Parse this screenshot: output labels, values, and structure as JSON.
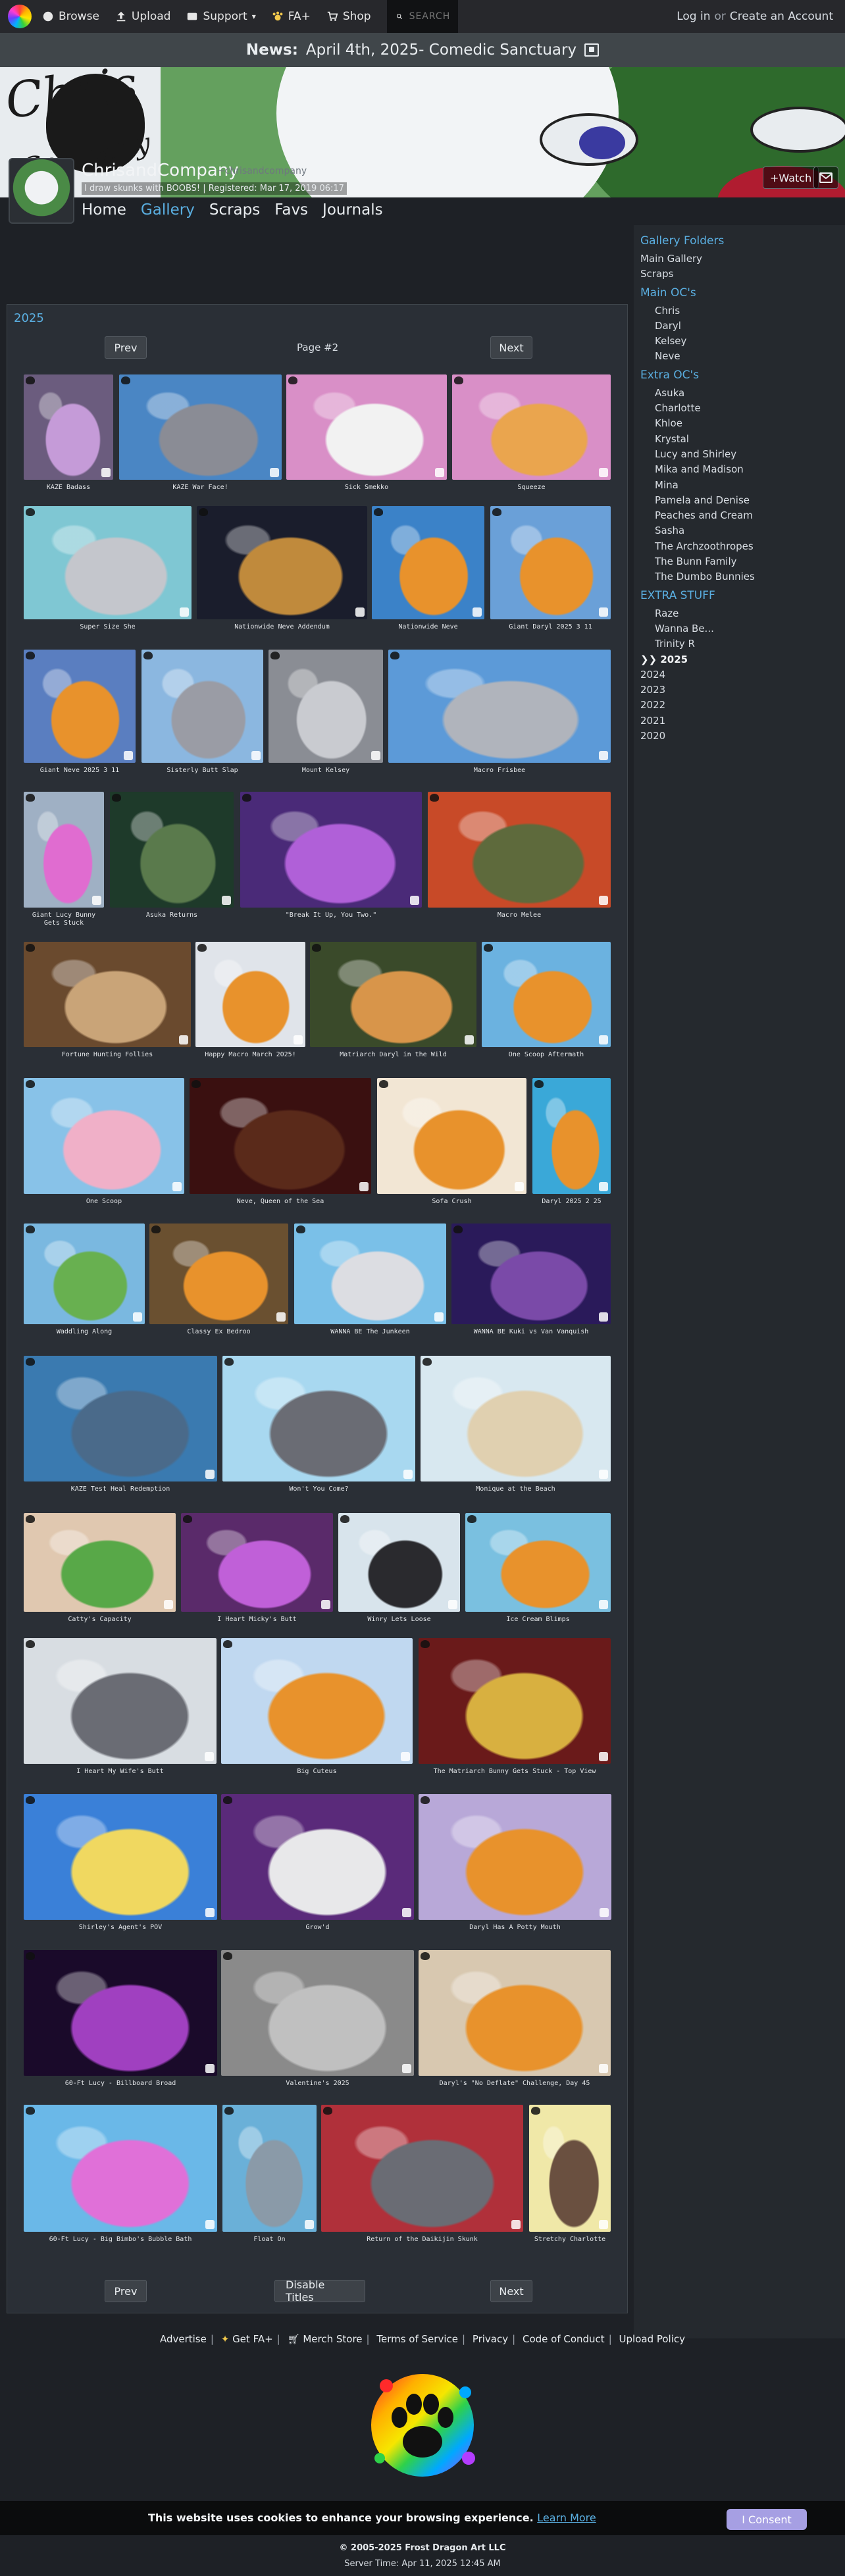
{
  "nav": {
    "browse": "Browse",
    "upload": "Upload",
    "support": "Support",
    "fa_plus": "FA+",
    "shop": "Shop",
    "search_placeholder": "SEARCH",
    "login": "Log in",
    "or": "or",
    "create_account": "Create an Account"
  },
  "news": {
    "label": "News:",
    "text": "April 4th, 2025- Comedic Sanctuary"
  },
  "profile": {
    "username": "ChrisandCompany",
    "title": "~chrisandcompany",
    "description": "I draw skunks with BOOBS! | Registered: Mar 17, 2019 06:17",
    "watch": "+Watch",
    "tabs": [
      "Home",
      "Gallery",
      "Scraps",
      "Favs",
      "Journals"
    ]
  },
  "gallery": {
    "year": "2025",
    "prev": "Prev",
    "next": "Next",
    "page": "Page #2",
    "disable_titles": "Disable Titles",
    "items": [
      {
        "title": "KAZE Badass",
        "bg": "#6b5c7e",
        "fg": "#c59bd8"
      },
      {
        "title": "KAZE War Face!",
        "bg": "#4a86c4",
        "fg": "#8a8c95"
      },
      {
        "title": "Sick Smekko",
        "bg": "#d98fc7",
        "fg": "#f2f2f2"
      },
      {
        "title": "Squeeze",
        "bg": "#d98fc7",
        "fg": "#eaa54e"
      },
      {
        "title": "Super Size She",
        "bg": "#7fc7d3",
        "fg": "#c4c6cc"
      },
      {
        "title": "Nationwide Neve Addendum",
        "bg": "#1a1d2c",
        "fg": "#c08a3c"
      },
      {
        "title": "Nationwide Neve",
        "bg": "#3b82c8",
        "fg": "#e8922c"
      },
      {
        "title": "Giant Daryl 2025 3 11",
        "bg": "#6aa0d8",
        "fg": "#e8922c"
      },
      {
        "title": "Giant Neve 2025 3 11",
        "bg": "#5a7ec0",
        "fg": "#e8922c"
      },
      {
        "title": "Sisterly Butt Slap",
        "bg": "#8bb7e0",
        "fg": "#9a9ca5"
      },
      {
        "title": "Mount Kelsey",
        "bg": "#8a8d94",
        "fg": "#c9cbd0"
      },
      {
        "title": "Macro Frisbee",
        "bg": "#5c9ad8",
        "fg": "#b0b4bc"
      },
      {
        "title": "Giant Lucy Bunny Gets Stuck",
        "bg": "#9fb0c4",
        "fg": "#e06cd0"
      },
      {
        "title": "Asuka Returns",
        "bg": "#1e3a2a",
        "fg": "#5a7a4c"
      },
      {
        "title": "\"Break It Up, You Two.\"",
        "bg": "#4a2a78",
        "fg": "#b060d8"
      },
      {
        "title": "Macro Melee",
        "bg": "#c84a28",
        "fg": "#5e6a3c"
      },
      {
        "title": "Fortune Hunting Follies",
        "bg": "#6a4a2e",
        "fg": "#c9a478"
      },
      {
        "title": "Happy Macro March 2025!",
        "bg": "#e0e4ea",
        "fg": "#e8922c"
      },
      {
        "title": "Matriarch Daryl in the Wild",
        "bg": "#3a4a2a",
        "fg": "#d8954a"
      },
      {
        "title": "One Scoop Aftermath",
        "bg": "#6bb2e0",
        "fg": "#e8922c"
      },
      {
        "title": "One Scoop",
        "bg": "#88c2e8",
        "fg": "#f0b0c8"
      },
      {
        "title": "Neve, Queen of the Sea",
        "bg": "#3a1010",
        "fg": "#5a2a1a"
      },
      {
        "title": "Sofa Crush",
        "bg": "#f2e6d4",
        "fg": "#e8922c"
      },
      {
        "title": "Daryl 2025 2 25",
        "bg": "#3aa8d8",
        "fg": "#e8922c"
      },
      {
        "title": "Waddling Along",
        "bg": "#7ab8e0",
        "fg": "#68b050"
      },
      {
        "title": "Classy Ex Bedroo",
        "bg": "#6a5030",
        "fg": "#e8922c"
      },
      {
        "title": "WANNA BE The Junkeen",
        "bg": "#7ac0e8",
        "fg": "#dcdde2"
      },
      {
        "title": "WANNA BE Kuki vs Van Vanquish",
        "bg": "#2a1a5a",
        "fg": "#7a4aa8"
      },
      {
        "title": "KAZE Test Heal Redemption",
        "bg": "#3a7ab0",
        "fg": "#4a6a8a"
      },
      {
        "title": "Won't You Come?",
        "bg": "#a8d8f0",
        "fg": "#6a6c74"
      },
      {
        "title": "Monique at the Beach",
        "bg": "#d8e8f0",
        "fg": "#e0d0b0"
      },
      {
        "title": "Catty's Capacity",
        "bg": "#e0c8b0",
        "fg": "#58a848"
      },
      {
        "title": "I Heart Micky's Butt",
        "bg": "#5a2a6a",
        "fg": "#c060d8"
      },
      {
        "title": "Winry Lets Loose",
        "bg": "#d8e4ec",
        "fg": "#2a2a2e"
      },
      {
        "title": "Ice Cream Blimps",
        "bg": "#7ac0e0",
        "fg": "#e8922c"
      },
      {
        "title": "I Heart My Wife's Butt",
        "bg": "#d8dde2",
        "fg": "#6a6c74"
      },
      {
        "title": "Big Cuteus",
        "bg": "#c0d8f0",
        "fg": "#e8922c"
      },
      {
        "title": "The Matriarch Bunny Gets Stuck - Top View",
        "bg": "#6a1a1a",
        "fg": "#d8b040"
      },
      {
        "title": "Shirley's Agent's POV",
        "bg": "#3a80d8",
        "fg": "#f0d860"
      },
      {
        "title": "Grow'd",
        "bg": "#5a2a7a",
        "fg": "#e8e8ea"
      },
      {
        "title": "Daryl Has A Potty Mouth",
        "bg": "#b8a8d8",
        "fg": "#e8922c"
      },
      {
        "title": "60-Ft Lucy - Billboard Broad",
        "bg": "#1a0a2a",
        "fg": "#a040c0"
      },
      {
        "title": "Valentine's 2025",
        "bg": "#8a8a8a",
        "fg": "#c0c0c0"
      },
      {
        "title": "Daryl's \"No Deflate\" Challenge, Day 45",
        "bg": "#d8c8b0",
        "fg": "#e8922c"
      },
      {
        "title": "60-Ft Lucy - Big Bimbo's Bubble Bath",
        "bg": "#6ab8e8",
        "fg": "#e070d8"
      },
      {
        "title": "Float On",
        "bg": "#6ab0d8",
        "fg": "#8a9aa8"
      },
      {
        "title": "Return of the Daikijin Skunk",
        "bg": "#b0303a",
        "fg": "#6a6c74"
      },
      {
        "title": "Stretchy Charlotte",
        "bg": "#f0e8a8",
        "fg": "#6a5040"
      }
    ]
  },
  "sidebar": {
    "folders_title": "Gallery Folders",
    "folders": [
      "Main Gallery",
      "Scraps"
    ],
    "main_ocs_title": "Main OC's",
    "main_ocs": [
      "Chris",
      "Daryl",
      "Kelsey",
      "Neve"
    ],
    "extra_ocs_title": "Extra OC's",
    "extra_ocs": [
      "Asuka",
      "Charlotte",
      "Khloe",
      "Krystal",
      "Lucy and Shirley",
      "Mika and Madison",
      "Mina",
      "Pamela and Denise",
      "Peaches and Cream",
      "Sasha",
      "The Archzoothropes",
      "The Bunn Family",
      "The Dumbo Bunnies"
    ],
    "extra_stuff_title": "EXTRA STUFF",
    "extra_stuff": [
      "Raze",
      "Wanna Be...",
      "Trinity R"
    ],
    "years": [
      "❯❯ 2025",
      "2024",
      "2023",
      "2022",
      "2021",
      "2020"
    ]
  },
  "footer": {
    "advertise": "Advertise",
    "get_fa_plus": "Get FA+",
    "merch": "Merch Store",
    "tos": "Terms of Service",
    "privacy": "Privacy",
    "coc": "Code of Conduct",
    "upload_policy": "Upload Policy",
    "cookie_text": "This website uses cookies to enhance your browsing experience.",
    "learn_more": "Learn More",
    "consent": "I Consent",
    "copyright": "© 2005-2025 Frost Dragon Art LLC",
    "server_time": "Server Time: Apr 11, 2025 12:45 AM"
  },
  "colors": {
    "accent": "#5aaee0",
    "page_bg": "#1e2126",
    "panel_bg": "#2a2f36",
    "consent_bg": "#a69fe3"
  }
}
